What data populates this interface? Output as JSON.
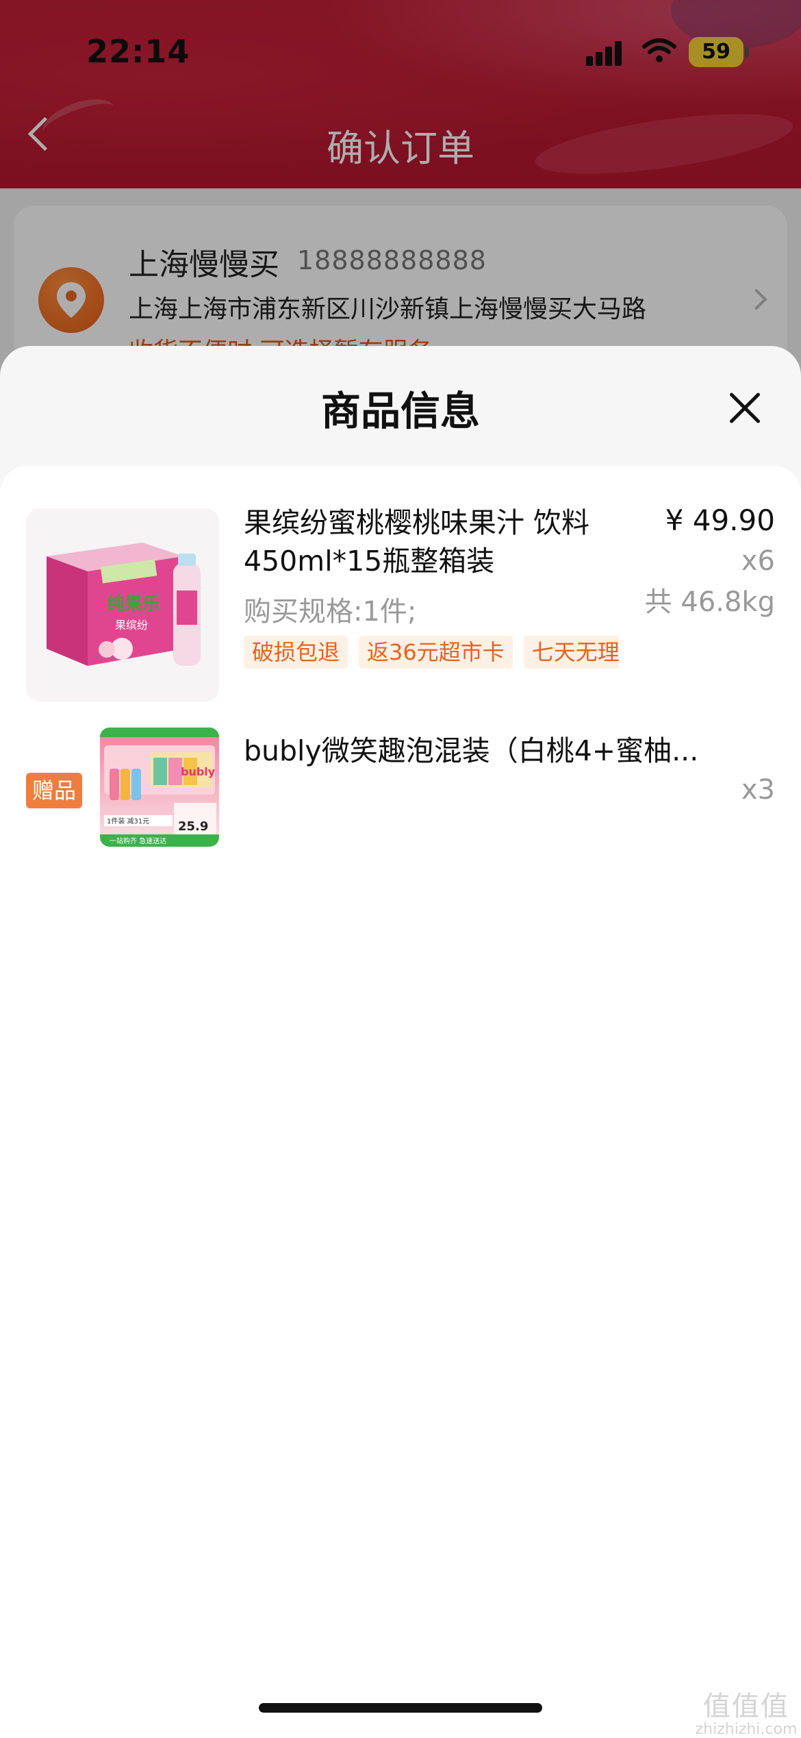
{
  "status_bar": {
    "time": "22:14",
    "battery": "59",
    "icons": [
      "signal-icon",
      "wifi-icon",
      "battery-icon"
    ]
  },
  "nav": {
    "title": "确认订单",
    "back_icon": "chevron-left-icon"
  },
  "address": {
    "name": "上海慢慢买",
    "phone": "18888888888",
    "line": "上海上海市浦东新区川沙新镇上海慢慢买大马路",
    "note": "收货不便时,可选择暂存服务",
    "icon": "location-pin-icon",
    "chevron_icon": "chevron-right-icon"
  },
  "sheet": {
    "title": "商品信息",
    "close_icon": "close-icon"
  },
  "items": [
    {
      "title": "果缤纷蜜桃樱桃味果汁 饮料450ml*15瓶整箱装",
      "spec": "购买规格:1件;",
      "tags": [
        "破损包退",
        "返36元超市卡",
        "七天无理由退货"
      ],
      "price": "¥ 49.90",
      "quantity": "x6",
      "weight": "共 46.8kg",
      "image_texts": {
        "brand": "纯果乐",
        "sub": "果缤纷"
      }
    },
    {
      "badge": "赠品",
      "title": "bubly微笑趣泡混装（白桃4+蜜柚...",
      "quantity": "x3",
      "image_texts": {
        "logo": "bubly",
        "bottom": "1件装 减31元",
        "price": "25.9",
        "foot": "一站购齐 急速送达"
      }
    }
  ],
  "watermark": {
    "mark": "值值值",
    "url": "zhizhizhi.com"
  },
  "colors": {
    "header_red": "#c21f35",
    "accent_orange": "#e8621e",
    "tag_bg": "#fdf1e5",
    "gift_badge": "#ef7d3d"
  }
}
